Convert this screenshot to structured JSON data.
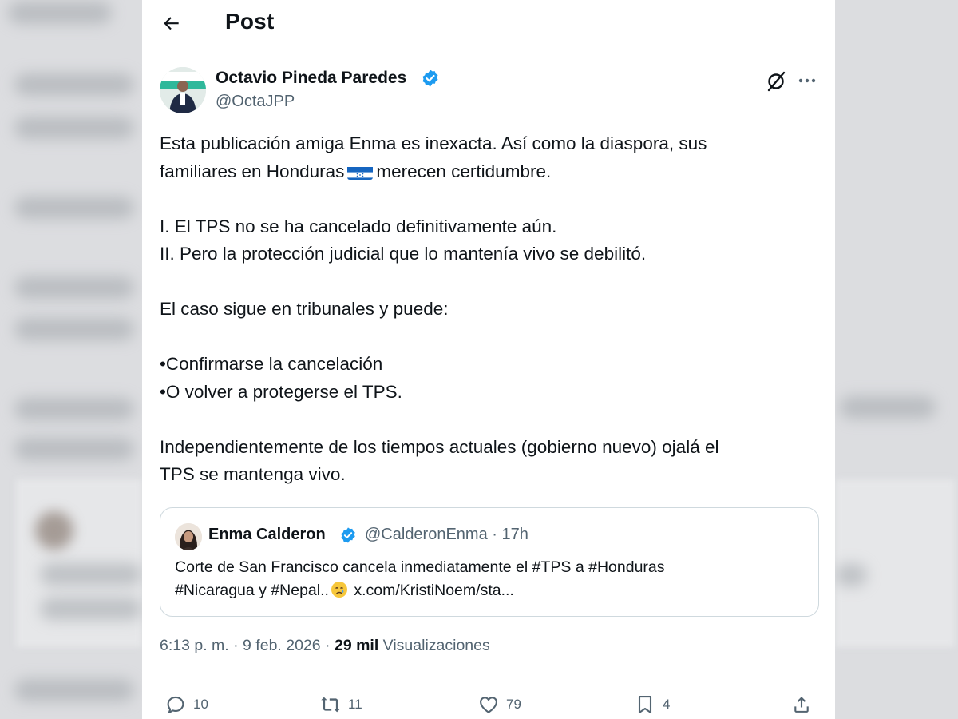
{
  "header": {
    "title": "Post",
    "back_icon": "arrow-left-icon"
  },
  "post": {
    "author_name": "Octavio Pineda Paredes",
    "author_handle": "@OctaJPP",
    "verified": true,
    "lines": {
      "l1": "Esta publicación amiga Enma es inexacta. Así como la diaspora, sus",
      "l2a": "familiares en Honduras",
      "l2b": "merecen certidumbre.",
      "l3": "I. El TPS no se ha cancelado definitivamente aún.",
      "l4": "II. Pero la protección judicial que lo mantenía vivo se debilitó.",
      "l5": "El caso sigue en tribunales y puede:",
      "l6": "•Confirmarse la cancelación",
      "l7": "•O volver a protegerse el TPS.",
      "l8": "Independientemente de los tiempos actuales (gobierno nuevo) ojalá el",
      "l9": "TPS se mantenga vivo."
    },
    "flag_icon": "honduras-flag-icon"
  },
  "quote": {
    "name": "Enma Calderon",
    "handle_time": "@CalderonEnma · 17h",
    "line1": "Corte de San Francisco cancela inmediatamente el #TPS a #Honduras",
    "line2a": "#Nicaragua  y #Nepal..",
    "line2b": "x.com/KristiNoem/sta...",
    "emoji_icon": "crying-face-icon"
  },
  "meta": {
    "timestamp": "6:13 p. m. · 9 feb. 2026 · ",
    "views_count": "29 mil",
    "views_label": " Visualizaciones"
  },
  "actions": {
    "replies": "10",
    "reposts": "11",
    "likes": "79",
    "bookmarks": "4"
  },
  "colors": {
    "text": "#0f1419",
    "secondary": "#536471",
    "verified": "#1d9bf0",
    "border": "#cfd9de"
  }
}
